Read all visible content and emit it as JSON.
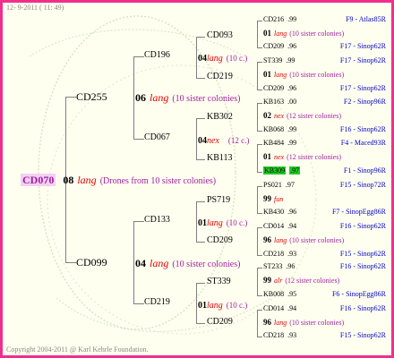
{
  "header": {
    "date": "12- 9-2011 ( 11: 49)"
  },
  "footer": {
    "copyright": "Copyright 2004-2011 @ Karl Kehrle Foundation."
  },
  "root": {
    "name": "CD070",
    "gen": "08",
    "breed": "lang",
    "note": "(Drones from 10 sister colonies)"
  },
  "level1": [
    {
      "name": "CD255",
      "gen": "06",
      "breed": "lang",
      "note": "(10 sister colonies)"
    },
    {
      "name": "CD099",
      "gen": "04",
      "breed": "lang",
      "note": "(10 sister colonies)"
    }
  ],
  "level2": [
    {
      "name": "CD196",
      "gen": "04",
      "breed": "lang",
      "note": "(10 c.)"
    },
    {
      "name": "CD067",
      "gen": "04",
      "breed": "nex",
      "note": "(12 c.)"
    },
    {
      "name": "CD133",
      "gen": "01",
      "breed": "lang",
      "note": "(10 c.)"
    },
    {
      "name": "CD219",
      "gen": "01",
      "breed": "lang",
      "note": "(10 c.)"
    }
  ],
  "level3": [
    {
      "name": "CD093"
    },
    {
      "name": "CD219"
    },
    {
      "name": "KB302"
    },
    {
      "name": "KB113"
    },
    {
      "name": "PS719"
    },
    {
      "name": "CD209"
    },
    {
      "name": "ST339"
    },
    {
      "name": "CD209"
    }
  ],
  "level4": [
    {
      "name": "CD216",
      "year": ".99",
      "id": "F9 - Atlas85R"
    },
    {
      "gen": "01",
      "breed": "lang",
      "note": "(10 sister colonies)"
    },
    {
      "name": "CD209",
      "year": ".96",
      "id": "F17 - Sinop62R"
    },
    {
      "name": "ST339",
      "year": ".99",
      "id": "F17 - Sinop62R"
    },
    {
      "gen": "01",
      "breed": "lang",
      "note": "(10 sister colonies)"
    },
    {
      "name": "CD209",
      "year": ".96",
      "id": "F17 - Sinop62R"
    },
    {
      "name": "KB163",
      "year": ".00",
      "id": "F2 - Sinop96R"
    },
    {
      "gen": "02",
      "breed": "nex",
      "note": "(12 sister colonies)"
    },
    {
      "name": "KB068",
      "year": ".99",
      "id": "F16 - Sinop62R"
    },
    {
      "name": "KB484",
      "year": ".99",
      "id": "F4 - Maced93R"
    },
    {
      "gen": "01",
      "breed": "nex",
      "note": "(12 sister colonies)"
    },
    {
      "name": "KB309",
      "year": ".97",
      "id": "F1 - Sinop96R"
    },
    {
      "name": "PS021",
      "year": ".97",
      "id": "F15 - Sinop72R"
    },
    {
      "gen": "99",
      "breed": "fun",
      "note": ""
    },
    {
      "name": "KB430",
      "year": ".96",
      "id": "F7 - SinopEgg86R"
    },
    {
      "name": "CD014",
      "year": ".94",
      "id": "F16 - Sinop62R"
    },
    {
      "gen": "96",
      "breed": "lang",
      "note": "(10 sister colonies)"
    },
    {
      "name": "CD218",
      "year": ".93",
      "id": "F15 - Sinop62R"
    },
    {
      "name": "ST233",
      "year": ".96",
      "id": "F16 - Sinop62R"
    },
    {
      "gen": "99",
      "breed": "alr",
      "note": "(12 sister colonies)"
    },
    {
      "name": "KB008",
      "year": ".95",
      "id": "F6 - SinopEgg86R"
    },
    {
      "name": "CD014",
      "year": ".94",
      "id": "F16 - Sinop62R"
    },
    {
      "gen": "96",
      "breed": "lang",
      "note": "(10 sister colonies)"
    },
    {
      "name": "CD218",
      "year": ".93",
      "id": "F15 - Sinop62R"
    }
  ]
}
